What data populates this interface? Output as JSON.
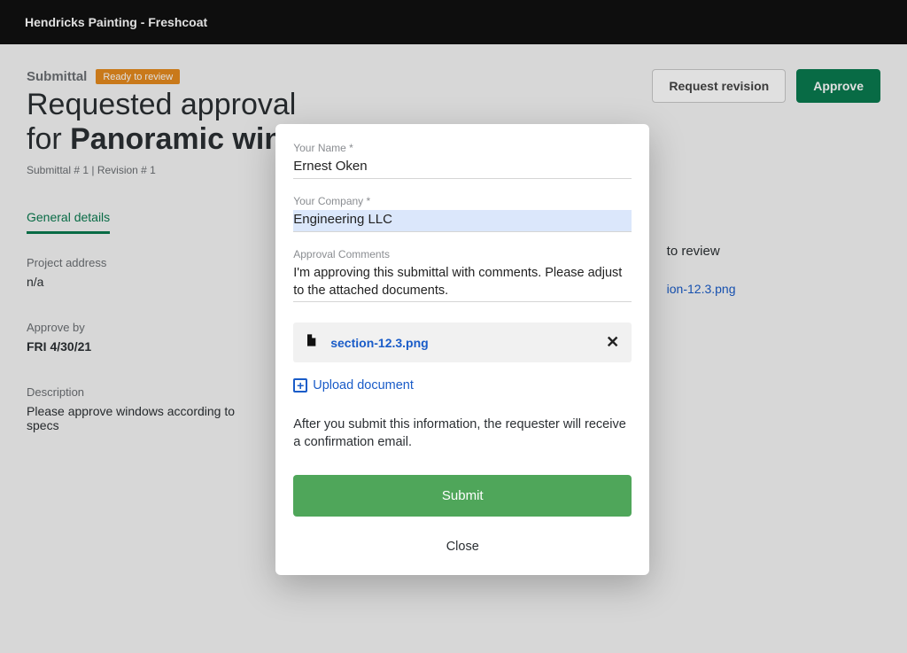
{
  "topbar": {
    "title": "Hendricks Painting - Freshcoat"
  },
  "header": {
    "submittal_label": "Submittal",
    "badge": "Ready to review",
    "title_line1": "Requested approval",
    "title_line2_prefix": "for ",
    "title_line2_bold": "Panoramic windo",
    "meta": "Submittal # 1 | Revision # 1",
    "request_revision_btn": "Request revision",
    "approve_btn": "Approve"
  },
  "tabs": {
    "general": "General details"
  },
  "right_hint": {
    "to_review": "to review",
    "file_fragment": "ion-12.3.png"
  },
  "details": {
    "project_address_label": "Project address",
    "project_address_value": "n/a",
    "approve_by_label": "Approve by",
    "approve_by_value": "FRI 4/30/21",
    "description_label": "Description",
    "description_value": "Please approve windows according to specs"
  },
  "modal": {
    "name_label": "Your Name *",
    "name_value": "Ernest Oken",
    "company_label": "Your Company *",
    "company_value": "Engineering LLC",
    "comments_label": "Approval Comments",
    "comments_value": "I'm approving this submittal with comments. Please adjust to the attached documents.",
    "attachment_name": "section-12.3.png",
    "upload_label": "Upload document",
    "info": "After you submit this information, the requester will receive a confirmation email.",
    "submit": "Submit",
    "close": "Close"
  }
}
